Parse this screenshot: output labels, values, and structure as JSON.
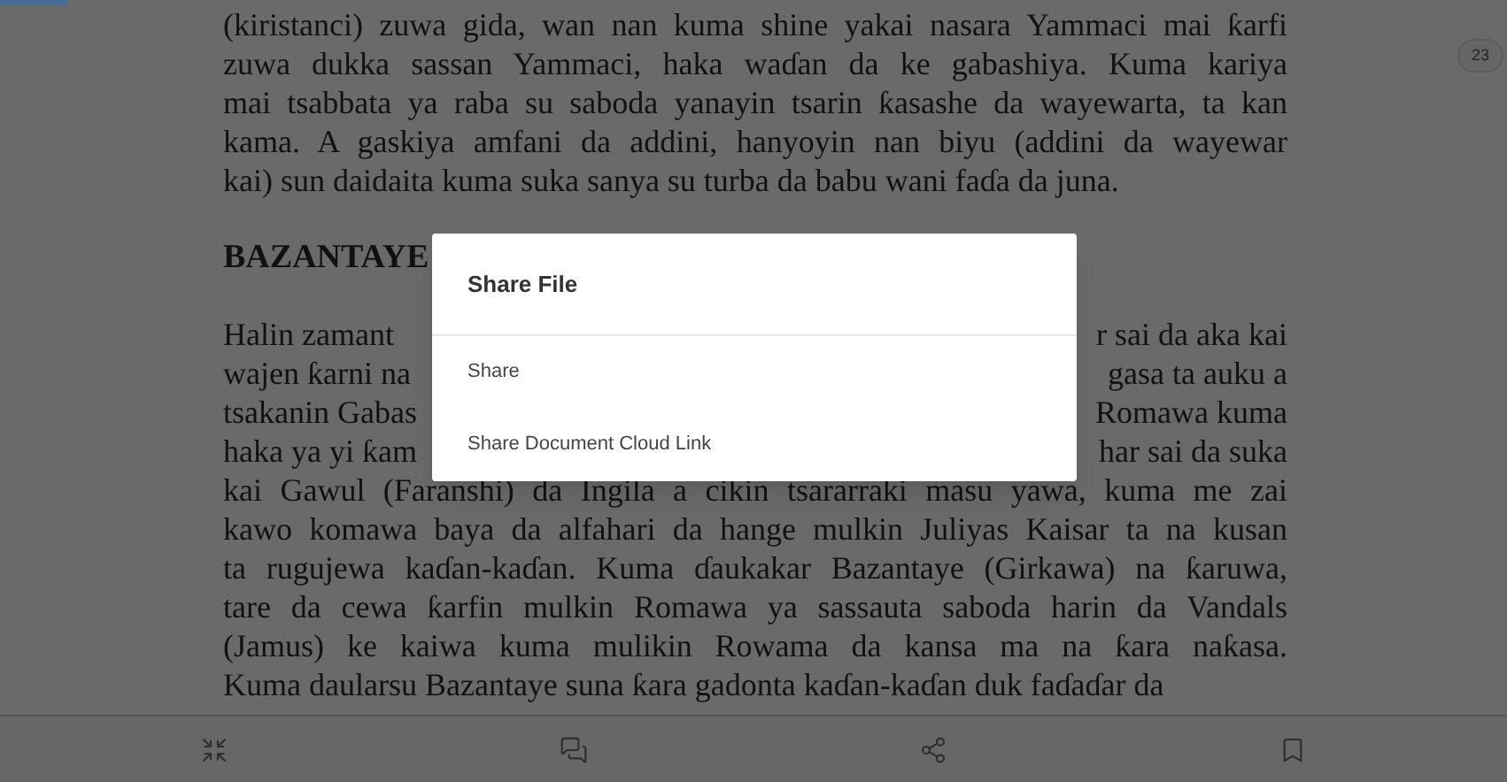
{
  "document": {
    "paragraphs": [
      {
        "kind": "text",
        "lines": [
          {
            "left": "(kiristanci) zuwa gida, wan nan kuma shine yakai nasara Yammaci mai ƙarfi"
          },
          {
            "left": "zuwa dukka sassan Yammaci, haka waɗan da ke gabashiya. Kuma kariya"
          },
          {
            "left": "mai tsabbata ya raba su saboda yanayin tsarin ƙasashe da wayewarta, ta kan"
          },
          {
            "left": "kama. A gaskiya amfani da addini, hanyoyin nan biyu (addini da wayewar"
          },
          {
            "left": "kai) sun daidaita kuma suka sanya su turba da babu wani faɗa da juna."
          }
        ]
      },
      {
        "kind": "heading",
        "lines": [
          {
            "left": "BAZANTAYE"
          }
        ]
      },
      {
        "kind": "text",
        "lines": [
          {
            "left": "Halin zamant",
            "right": "r sai da aka kai"
          },
          {
            "left": "wajen ƙarni na",
            "right": "gasa ta auku a"
          },
          {
            "left": "tsakanin Gabas",
            "right": "Romawa kuma"
          },
          {
            "left": "haka ya yi ƙam",
            "right": "har sai da suka"
          },
          {
            "left": "kai Gawul (Faranshi) da Ingila a cikin tsararraki masu yawa, kuma me zai"
          },
          {
            "left": "kawo komawa baya da alfahari da hange mulkin Juliyas Kaisar ta na kusan"
          },
          {
            "left": "ta rugujewa kaɗan-kaɗan. Kuma ɗaukakar Bazantaye (Girkawa) na ƙaruwa,"
          },
          {
            "left": "tare da cewa ƙarfin mulkin Romawa ya sassauta saboda harin da Vandals"
          },
          {
            "left": "(Jamus) ke kaiwa kuma mulikin Rowama da kansa ma na ƙara naƙasa."
          },
          {
            "left": "Kuma daularsu Bazantaye suna ƙara gadonta kaɗan-kaɗan duk faɗaɗar da"
          }
        ]
      }
    ]
  },
  "page_number": "23",
  "dialog": {
    "title": "Share File",
    "options": [
      "Share",
      "Share Document Cloud Link"
    ]
  },
  "toolbar": [
    {
      "kind": "fit"
    },
    {
      "kind": "comment"
    },
    {
      "kind": "share"
    },
    {
      "kind": "bookmark"
    }
  ]
}
